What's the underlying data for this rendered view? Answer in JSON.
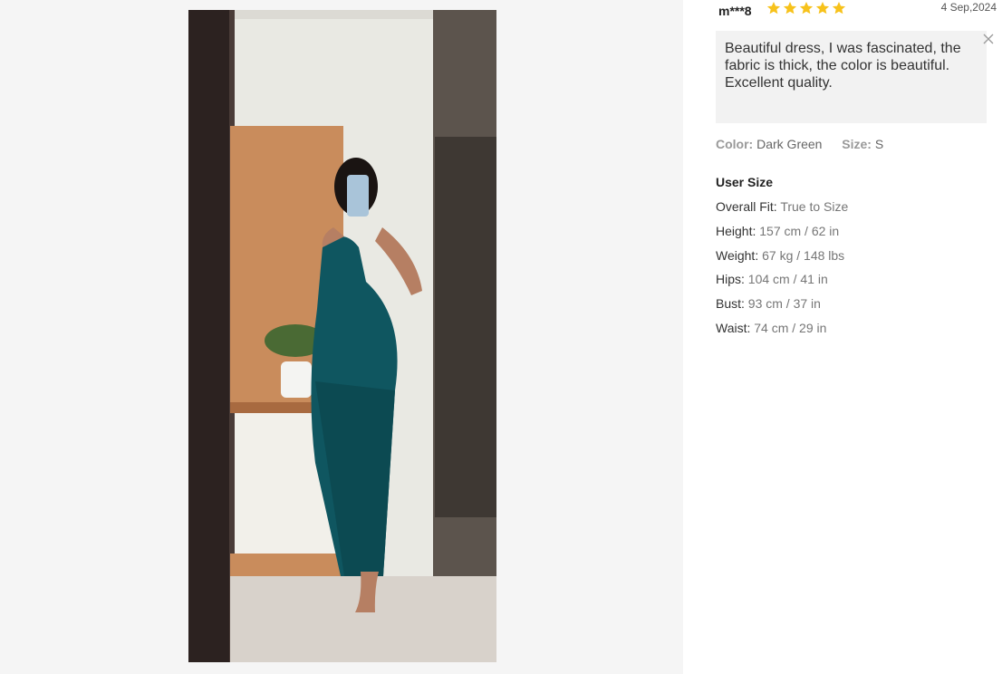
{
  "review": {
    "reviewer": "m***8",
    "rating": 5,
    "date": "4 Sep,2024",
    "comment": "Beautiful dress, I was fascinated, the fabric is thick, the color is beautiful. Excellent quality.",
    "color_label": "Color:",
    "color_value": "Dark Green",
    "size_label": "Size:",
    "size_value": "S"
  },
  "user_size": {
    "title": "User Size",
    "rows": [
      {
        "label": "Overall Fit:",
        "value": "True to Size"
      },
      {
        "label": "Height:",
        "value": "157 cm / 62 in"
      },
      {
        "label": "Weight:",
        "value": "67 kg / 148 lbs"
      },
      {
        "label": "Hips:",
        "value": "104 cm / 41 in"
      },
      {
        "label": "Bust:",
        "value": "93 cm / 37 in"
      },
      {
        "label": "Waist:",
        "value": "74 cm / 29 in"
      }
    ]
  },
  "colors": {
    "star": "#f7c21b",
    "dress": "#0f5660",
    "panel": "#f2f2f2"
  }
}
